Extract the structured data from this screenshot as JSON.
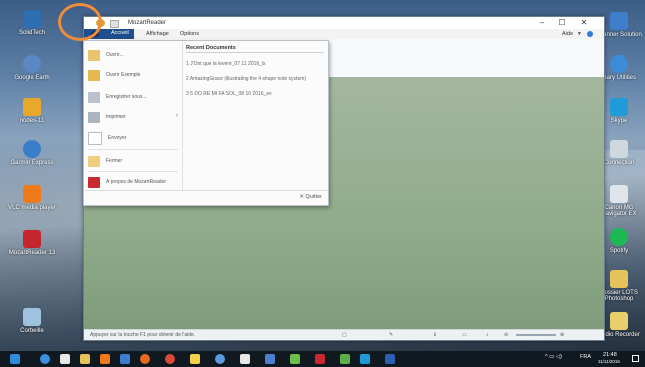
{
  "desktop": {
    "left_icons": [
      "SolidTech",
      "Google Earth",
      "nodes-11",
      "Garmin Express",
      "VLC media player",
      "MozartReader 13",
      "Corbeille"
    ],
    "right_icons": [
      "Scanner Solution",
      "Gary Utilities",
      "Skype",
      "Connection",
      "Canon MG Navigator EX",
      "Spotify",
      "Dossier LOTS Photoshop",
      "Audio Recorder"
    ]
  },
  "window": {
    "title": "MozartReader",
    "aide_label": "Aide",
    "tabs": [
      "Accueil",
      "Affichage",
      "Options"
    ]
  },
  "file_menu": {
    "items": [
      "Ouvrir...",
      "Ouvrir Exemple",
      "Enregistrer sous...",
      "Imprimer",
      "Envoyer",
      "Fermer",
      "À propos de MozartReader"
    ],
    "recent_header": "Recent Documents",
    "recent": [
      "1 J'Ont que la leveré_07 11 2016_ls",
      "2 AmazingGrace (illustrating the 4 shape note system)",
      "3 5 DO RE MI FA SOL_08 10 2016_ex"
    ],
    "quit_label": "Quitter"
  },
  "status": {
    "hint": "Appuyer sur la touche F1 pour obtenir de l'aide."
  },
  "taskbar": {
    "language": "FRA",
    "time": "21:48",
    "date": "11/11/2016"
  },
  "colors": {
    "accent_tab": "#1f4e8c",
    "highlight_circle": "#f08c3a",
    "canvas": "#8fab8a"
  }
}
